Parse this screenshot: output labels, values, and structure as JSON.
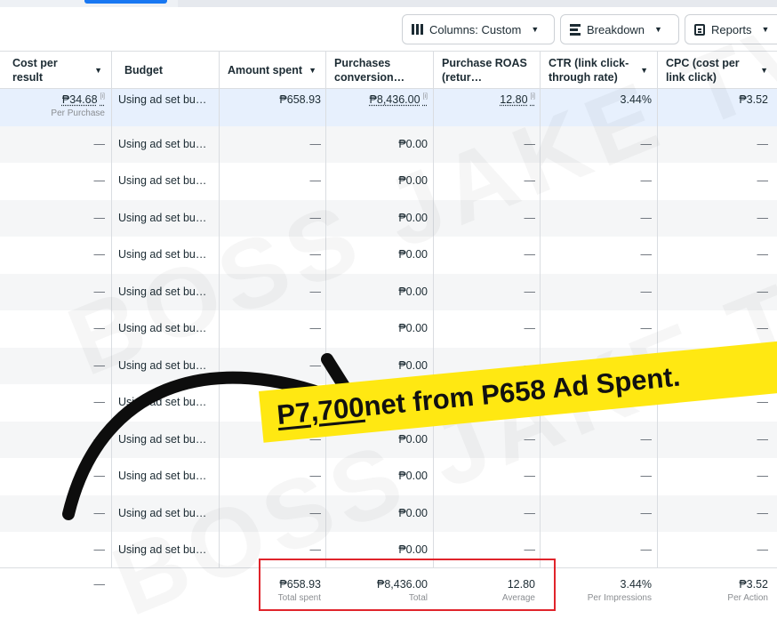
{
  "toolbar": {
    "columns_label": "Columns: Custom",
    "breakdown_label": "Breakdown",
    "reports_label": "Reports"
  },
  "headers": {
    "cost_per_result": "Cost per result",
    "budget": "Budget",
    "amount_spent": "Amount spent",
    "purchases_value": "Purchases conversion…",
    "purchase_roas": "Purchase ROAS (retur…",
    "ctr": "CTR (link click-through rate)",
    "cpc": "CPC (cost per link click)"
  },
  "first_row": {
    "cost_per_result": "₱34.68",
    "cost_per_result_sub": "Per Purchase",
    "budget": "Using ad set bu…",
    "amount_spent": "₱658.93",
    "purchases_value": "₱8,436.00",
    "purchase_roas": "12.80",
    "ctr": "3.44%",
    "cpc": "₱3.52"
  },
  "repeated_row": {
    "dash": "—",
    "budget": "Using ad set bu…",
    "purchases_value": "₱0.00"
  },
  "totals": {
    "cost_per_result": "—",
    "amount_spent": "₱658.93",
    "amount_spent_sub": "Total spent",
    "purchases_value": "₱8,436.00",
    "purchases_value_sub": "Total",
    "purchase_roas": "12.80",
    "purchase_roas_sub": "Average",
    "ctr": "3.44%",
    "ctr_sub": "Per Impressions",
    "cpc": "₱3.52",
    "cpc_sub": "Per Action"
  },
  "info_mark": "[i]",
  "banner": {
    "amount": "P7,700 ",
    "rest": "net from P658 Ad Spent."
  },
  "watermark": "BOSS JAKE TV",
  "colors": {
    "accent": "#1877f2",
    "banner_yellow": "#ffe812",
    "highlight_red": "#e0242b"
  }
}
